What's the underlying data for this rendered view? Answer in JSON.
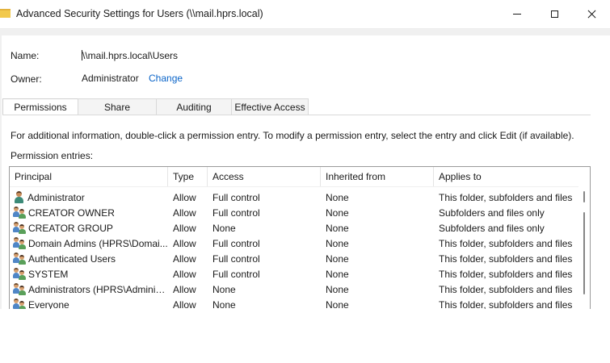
{
  "window": {
    "title": "Advanced Security Settings for Users (\\\\mail.hprs.local)"
  },
  "fields": {
    "name_label": "Name:",
    "name_value": "\\\\mail.hprs.local\\Users",
    "owner_label": "Owner:",
    "owner_value": "Administrator",
    "change_link": "Change"
  },
  "tabs": [
    {
      "label": "Permissions",
      "active": true
    },
    {
      "label": "Share",
      "active": false
    },
    {
      "label": "Auditing",
      "active": false
    },
    {
      "label": "Effective Access",
      "active": false
    }
  ],
  "info_text": "For additional information, double-click a permission entry. To modify a permission entry, select the entry and click Edit (if available).",
  "entries_label": "Permission entries:",
  "columns": [
    "Principal",
    "Type",
    "Access",
    "Inherited from",
    "Applies to"
  ],
  "entries": [
    {
      "principal": "Administrator",
      "icon": "user-icon",
      "type": "Allow",
      "access": "Full control",
      "inherited": "None",
      "applies": "This folder, subfolders and files"
    },
    {
      "principal": "CREATOR OWNER",
      "icon": "group-icon",
      "type": "Allow",
      "access": "Full control",
      "inherited": "None",
      "applies": "Subfolders and files only"
    },
    {
      "principal": "CREATOR GROUP",
      "icon": "group-icon",
      "type": "Allow",
      "access": "None",
      "inherited": "None",
      "applies": "Subfolders and files only"
    },
    {
      "principal": "Domain Admins (HPRS\\Domai...",
      "icon": "group-icon",
      "type": "Allow",
      "access": "Full control",
      "inherited": "None",
      "applies": "This folder, subfolders and files"
    },
    {
      "principal": "Authenticated Users",
      "icon": "group-icon",
      "type": "Allow",
      "access": "Full control",
      "inherited": "None",
      "applies": "This folder, subfolders and files"
    },
    {
      "principal": "SYSTEM",
      "icon": "group-icon",
      "type": "Allow",
      "access": "Full control",
      "inherited": "None",
      "applies": "This folder, subfolders and files"
    },
    {
      "principal": "Administrators (HPRS\\Adminis...",
      "icon": "group-icon",
      "type": "Allow",
      "access": "None",
      "inherited": "None",
      "applies": "This folder, subfolders and files"
    },
    {
      "principal": "Everyone",
      "icon": "group-icon",
      "type": "Allow",
      "access": "None",
      "inherited": "None",
      "applies": "This folder, subfolders and files"
    }
  ],
  "colors": {
    "link": "#0a64c8",
    "window_background": "#f0f0f0"
  }
}
